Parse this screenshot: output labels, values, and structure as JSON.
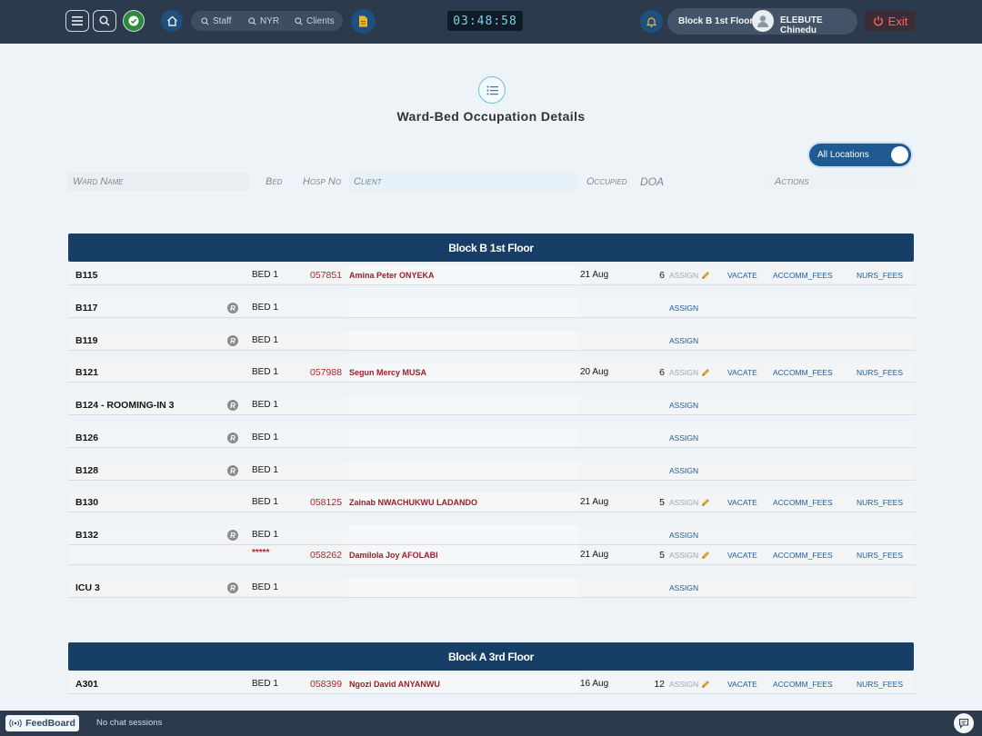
{
  "topbar": {
    "menu_icon": "hamburger-icon",
    "search_icon": "search-icon",
    "status_icon": "check-circle-icon",
    "home_icon": "home-icon",
    "quick_search": [
      {
        "label": "Staff",
        "icon": "search-icon"
      },
      {
        "label": "NYR",
        "icon": "search-icon"
      },
      {
        "label": "Clients",
        "icon": "search-icon"
      }
    ],
    "document_icon": "document-icon",
    "clock": "03:48:58",
    "bell_icon": "bell-icon",
    "location": "Block B 1st Floor",
    "user_name": "ELEBUTE Chinedu",
    "exit_label": "Exit"
  },
  "page": {
    "title": "Ward-Bed Occupation Details",
    "title_icon": "list-icon",
    "toggle_label": "All Locations"
  },
  "table_headers": {
    "ward": "Ward Name",
    "bed": "Bed",
    "hosp": "Hosp No",
    "client": "Client",
    "occupied": "Occupied",
    "doa": "DOA",
    "actions": "Actions"
  },
  "sections": [
    {
      "name": "Block B 1st Floor",
      "rows": [
        {
          "ward": "B115",
          "r": false,
          "bed": "BED 1",
          "hosp": "057851",
          "client": "Amina Peter ONYEKA",
          "occupied": "21 Aug",
          "doa": "6",
          "assign": "ASSIGN",
          "assign_active": false,
          "vacate": "VACATE",
          "accomm": "ACCOMM_FEES",
          "nurs": "NURS_FEES"
        },
        {
          "ward": "B117",
          "r": true,
          "bed": "BED 1",
          "hosp": "",
          "client": "",
          "occupied": "",
          "doa": "",
          "assign": "ASSIGN",
          "assign_active": true,
          "vacate": "",
          "accomm": "",
          "nurs": ""
        },
        {
          "ward": "B119",
          "r": true,
          "bed": "BED 1",
          "hosp": "",
          "client": "",
          "occupied": "",
          "doa": "",
          "assign": "ASSIGN",
          "assign_active": true,
          "vacate": "",
          "accomm": "",
          "nurs": ""
        },
        {
          "ward": "B121",
          "r": false,
          "bed": "BED 1",
          "hosp": "057988",
          "client": "Segun Mercy MUSA",
          "occupied": "20 Aug",
          "doa": "6",
          "assign": "ASSIGN",
          "assign_active": false,
          "vacate": "VACATE",
          "accomm": "ACCOMM_FEES",
          "nurs": "NURS_FEES"
        },
        {
          "ward": "B124 - ROOMING-IN 3",
          "r": true,
          "bed": "BED 1",
          "hosp": "",
          "client": "",
          "occupied": "",
          "doa": "",
          "assign": "ASSIGN",
          "assign_active": true,
          "vacate": "",
          "accomm": "",
          "nurs": ""
        },
        {
          "ward": "B126",
          "r": true,
          "bed": "BED 1",
          "hosp": "",
          "client": "",
          "occupied": "",
          "doa": "",
          "assign": "ASSIGN",
          "assign_active": true,
          "vacate": "",
          "accomm": "",
          "nurs": ""
        },
        {
          "ward": "B128",
          "r": true,
          "bed": "BED 1",
          "hosp": "",
          "client": "",
          "occupied": "",
          "doa": "",
          "assign": "ASSIGN",
          "assign_active": true,
          "vacate": "",
          "accomm": "",
          "nurs": ""
        },
        {
          "ward": "B130",
          "r": false,
          "bed": "BED 1",
          "hosp": "058125",
          "client": "Zainab NWACHUKWU LADANDO",
          "occupied": "21 Aug",
          "doa": "5",
          "assign": "ASSIGN",
          "assign_active": false,
          "vacate": "VACATE",
          "accomm": "ACCOMM_FEES",
          "nurs": "NURS_FEES"
        },
        {
          "ward": "B132",
          "r": true,
          "bed": "BED 1",
          "hosp": "",
          "client": "",
          "occupied": "",
          "doa": "",
          "assign": "ASSIGN",
          "assign_active": true,
          "vacate": "",
          "accomm": "",
          "nurs": ""
        },
        {
          "ward": "",
          "r": false,
          "bed": "*****",
          "hosp": "058262",
          "client": "Damilola Joy AFOLABI",
          "occupied": "21 Aug",
          "doa": "5",
          "assign": "ASSIGN",
          "assign_active": false,
          "vacate": "VACATE",
          "accomm": "ACCOMM_FEES",
          "nurs": "NURS_FEES"
        },
        {
          "ward": "ICU 3",
          "r": true,
          "bed": "BED 1",
          "hosp": "",
          "client": "",
          "occupied": "",
          "doa": "",
          "assign": "ASSIGN",
          "assign_active": true,
          "vacate": "",
          "accomm": "",
          "nurs": ""
        }
      ]
    },
    {
      "name": "Block A 3rd Floor",
      "rows": [
        {
          "ward": "A301",
          "r": false,
          "bed": "BED 1",
          "hosp": "058399",
          "client": "Ngozi David ANYANWU",
          "occupied": "16 Aug",
          "doa": "12",
          "assign": "ASSIGN",
          "assign_active": false,
          "vacate": "VACATE",
          "accomm": "ACCOMM_FEES",
          "nurs": "NURS_FEES"
        }
      ]
    }
  ],
  "bottombar": {
    "feedboard_label": "FeedBoard",
    "feedboard_icon": "broadcast-icon",
    "chat_status": "No chat sessions",
    "chat_icon": "chat-icon"
  },
  "colors": {
    "topbar": "#2b3a4c",
    "section_header": "#163e66",
    "link": "#1d5b9a",
    "patient": "#9b1f28",
    "exit": "#ff5f5f"
  }
}
